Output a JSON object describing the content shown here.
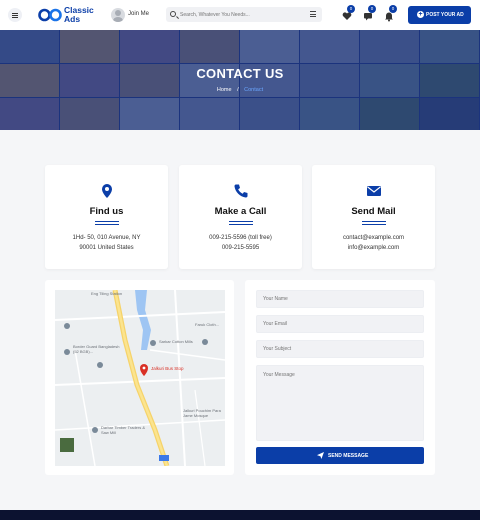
{
  "header": {
    "logo_line1": "Classic",
    "logo_line2": "Ads",
    "join_label": "Join Me",
    "search_placeholder": "Search, Whatever You Needs...",
    "favorites_count": "0",
    "messages_count": "0",
    "notifications_count": "0",
    "post_ad_label": "POST YOUR AD"
  },
  "hero": {
    "title": "CONTACT US",
    "breadcrumb_home": "Home",
    "breadcrumb_separator": "/",
    "breadcrumb_current": "Contact"
  },
  "cards": [
    {
      "icon": "map-marker-icon",
      "title": "Find us",
      "line1": "1Hd- 50, 010 Avenue, NY",
      "line2": "90001 United States"
    },
    {
      "icon": "phone-icon",
      "title": "Make a Call",
      "line1": "009-215-5596 (toll free)",
      "line2": "009-215-5595"
    },
    {
      "icon": "envelope-icon",
      "title": "Send Mail",
      "line1": "contact@example.com",
      "line2": "info@example.com"
    }
  ],
  "map": {
    "pin_label": "Jalkuri Bus Stop",
    "labels": [
      "Eng Tiling Station",
      "Border Guard Bangladesh (52 BGB)...",
      "Sarkar Cotton Mills",
      "Faruk Cloth...",
      "Jalkuri Pouchim Para Jame Mosque",
      "Darbar Timber Traders & Saw Mill"
    ]
  },
  "form": {
    "name_placeholder": "Your Name",
    "email_placeholder": "Your Email",
    "subject_placeholder": "Your Subject",
    "message_placeholder": "Your Message",
    "send_label": "SEND MESSAGE"
  },
  "colors": {
    "brand": "#0b3ea8",
    "accent": "#6aa6ff",
    "footer": "#0c1230"
  }
}
